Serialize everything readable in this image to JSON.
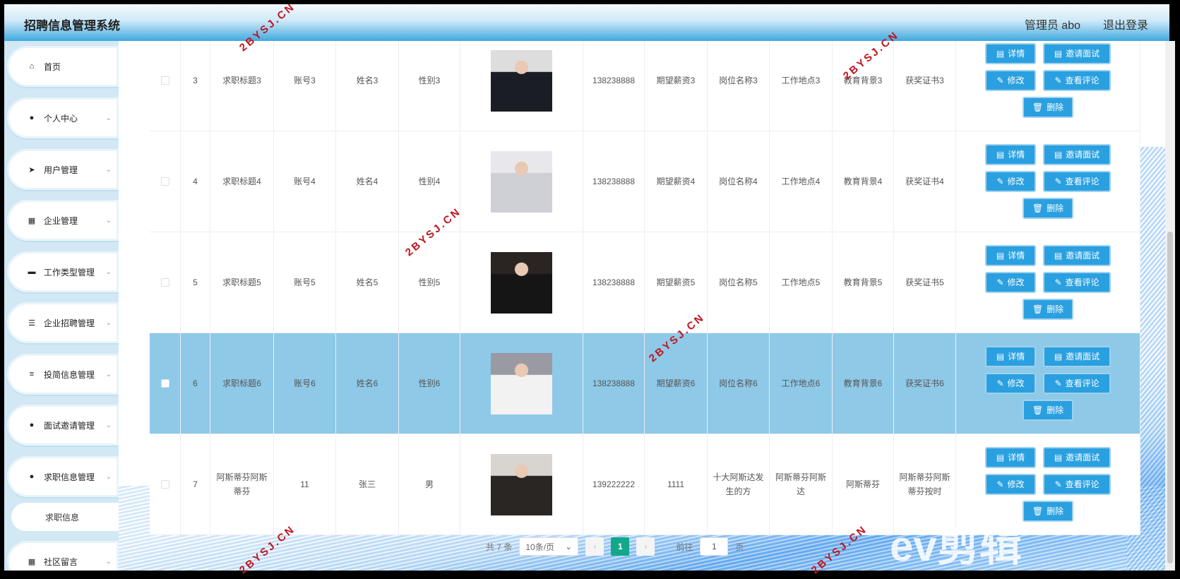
{
  "header": {
    "title": "招聘信息管理系统",
    "user": "管理员 abo",
    "logout": "退出登录"
  },
  "sidebar": {
    "items": [
      {
        "label": "首页",
        "icon": "home-icon",
        "glyph": "⌂",
        "chev": false
      },
      {
        "label": "个人中心",
        "icon": "user-icon",
        "glyph": "●",
        "chev": true
      },
      {
        "label": "用户管理",
        "icon": "send-icon",
        "glyph": "➤",
        "chev": true
      },
      {
        "label": "企业管理",
        "icon": "grid-icon",
        "glyph": "▦",
        "chev": true
      },
      {
        "label": "工作类型管理",
        "icon": "stamp-icon",
        "glyph": "▬",
        "chev": true
      },
      {
        "label": "企业招聘管理",
        "icon": "sliders-icon",
        "glyph": "☰",
        "chev": true
      },
      {
        "label": "投简信息管理",
        "icon": "list-icon",
        "glyph": "≡",
        "chev": true
      },
      {
        "label": "面试邀请管理",
        "icon": "pin-icon",
        "glyph": "●",
        "chev": true
      },
      {
        "label": "求职信息管理",
        "icon": "user-icon",
        "glyph": "●",
        "chev": true
      },
      {
        "label": "社区留言",
        "icon": "grid-icon",
        "glyph": "▦",
        "chev": true
      }
    ],
    "sub": "求职信息"
  },
  "table": {
    "rows": [
      {
        "idx": "3",
        "title": "求职标题3",
        "account": "账号3",
        "name": "姓名3",
        "gender": "性别3",
        "phone": "138238888",
        "salary": "期望薪资3",
        "position": "岗位名称3",
        "location": "工作地点3",
        "education": "教育背景3",
        "award": "获奖证书3",
        "photo_colors": [
          "#ddd",
          "#1a1d24"
        ]
      },
      {
        "idx": "4",
        "title": "求职标题4",
        "account": "账号4",
        "name": "姓名4",
        "gender": "性别4",
        "phone": "138238888",
        "salary": "期望薪资4",
        "position": "岗位名称4",
        "location": "工作地点4",
        "education": "教育背景4",
        "award": "获奖证书4",
        "photo_colors": [
          "#e8e8ec",
          "#cfcfd6"
        ]
      },
      {
        "idx": "5",
        "title": "求职标题5",
        "account": "账号5",
        "name": "姓名5",
        "gender": "性别5",
        "phone": "138238888",
        "salary": "期望薪资5",
        "position": "岗位名称5",
        "location": "工作地点5",
        "education": "教育背景5",
        "award": "获奖证书5",
        "photo_colors": [
          "#2a2522",
          "#151515"
        ]
      },
      {
        "idx": "6",
        "title": "求职标题6",
        "account": "账号6",
        "name": "姓名6",
        "gender": "性别6",
        "phone": "138238888",
        "salary": "期望薪资6",
        "position": "岗位名称6",
        "location": "工作地点6",
        "education": "教育背景6",
        "award": "获奖证书6",
        "photo_colors": [
          "#9a9aa2",
          "#f2f2f2"
        ],
        "highlighted": true
      },
      {
        "idx": "7",
        "title": "阿斯蒂芬阿斯蒂芬",
        "account": "11",
        "name": "张三",
        "gender": "男",
        "phone": "139222222",
        "salary": "1111",
        "position": "十大阿斯达发生的方",
        "location": "阿斯蒂芬阿斯达",
        "education": "阿斯蒂芬",
        "award": "阿斯蒂芬阿斯蒂芬按时",
        "photo_colors": [
          "#d8d4d0",
          "#2a2624"
        ]
      }
    ],
    "actions": {
      "detail": "详情",
      "invite": "邀请面试",
      "edit": "修改",
      "comments": "查看评论",
      "delete": "删除"
    }
  },
  "pagination": {
    "total": "共 7 条",
    "page_size": "10条/页",
    "current": "1",
    "goto_label": "前往",
    "goto_value": "1",
    "page_suffix": "页"
  },
  "watermarks": {
    "site": "2BYSJ.CN",
    "logo": "ev剪辑"
  },
  "colors": {
    "button": "#2aa0e0",
    "highlight_row": "#8ec9e8",
    "active_page": "#13a889"
  }
}
